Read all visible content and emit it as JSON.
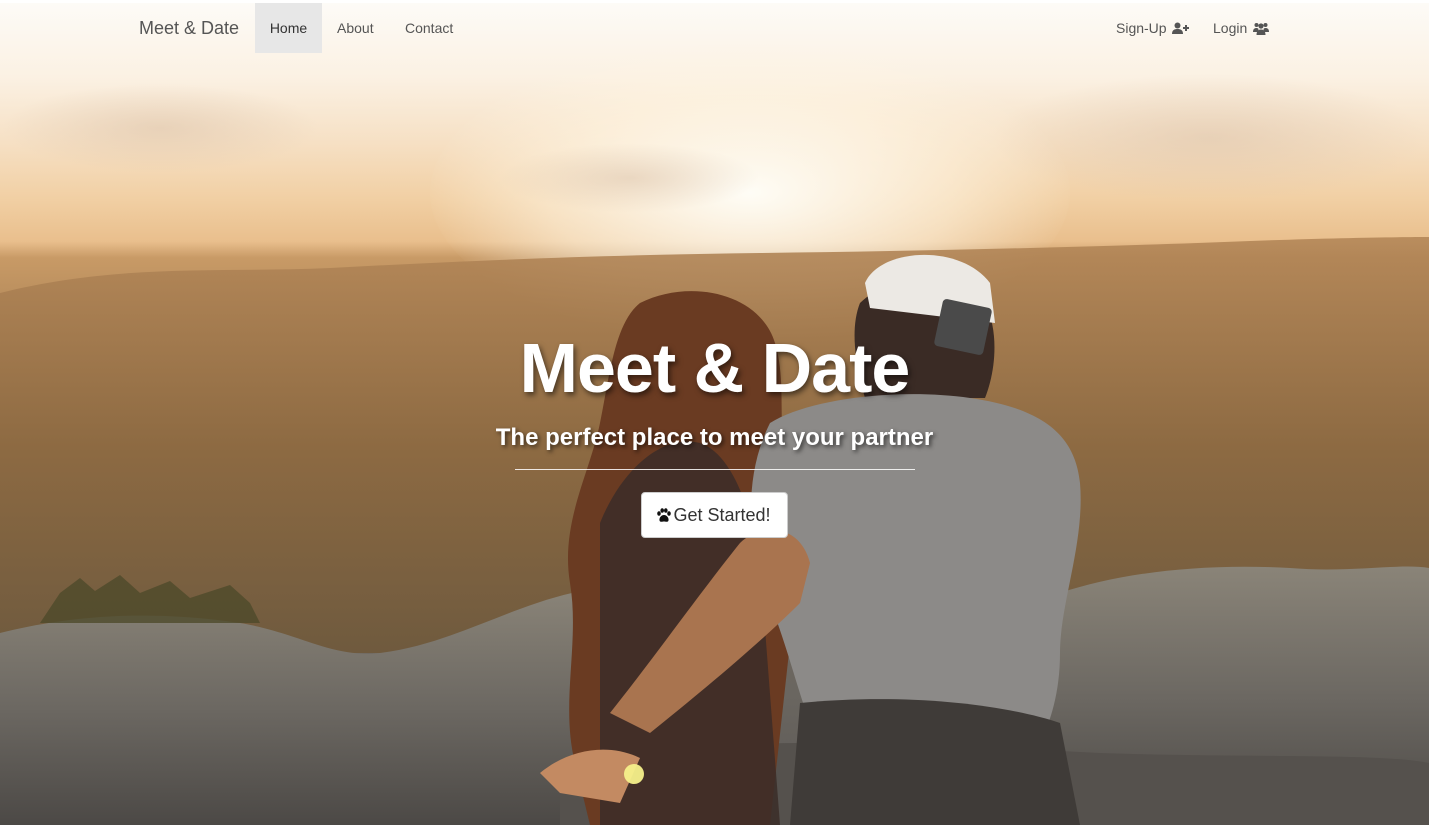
{
  "navbar": {
    "brand": "Meet & Date",
    "links": [
      {
        "label": "Home",
        "active": true
      },
      {
        "label": "About",
        "active": false
      },
      {
        "label": "Contact",
        "active": false
      }
    ],
    "signup_label": "Sign-Up",
    "signup_icon": "user-plus-icon",
    "login_label": "Login",
    "login_icon": "users-icon"
  },
  "hero": {
    "title": "Meet & Date",
    "subtitle": "The perfect place to meet your partner",
    "cta_label": "Get Started!",
    "cta_icon": "paw-icon"
  },
  "colors": {
    "nav_active_bg": "#e7e7e7",
    "nav_text": "#555555",
    "hero_text": "#ffffff",
    "button_bg": "#ffffff"
  }
}
